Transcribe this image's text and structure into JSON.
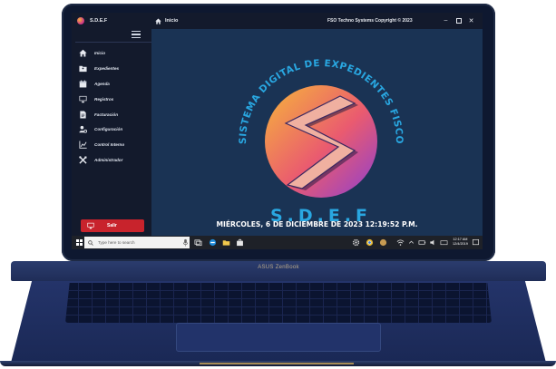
{
  "device": {
    "brand": "ASUS ZenBook"
  },
  "app": {
    "name": "S.D.E.F",
    "copyright": "FSO Techno Systems Copyright ©  2023",
    "breadcrumb": "Inicio"
  },
  "sidebar": {
    "items": [
      {
        "label": "Inicio",
        "icon": "home-icon"
      },
      {
        "label": "Expedientes",
        "icon": "folder-icon"
      },
      {
        "label": "Agenda",
        "icon": "calendar-icon"
      },
      {
        "label": "Registros",
        "icon": "monitor-icon"
      },
      {
        "label": "Facturación",
        "icon": "invoice-icon"
      },
      {
        "label": "Configuración",
        "icon": "user-gear-icon"
      },
      {
        "label": "Control Interno",
        "icon": "chart-icon"
      },
      {
        "label": "Administrador",
        "icon": "tools-icon"
      }
    ],
    "exit_label": "Salir"
  },
  "main": {
    "logo_arc_text": "SISTEMA DIGITAL DE EXPEDIENTES FISCO",
    "logo_acronym": "S.D.E.F",
    "datetime": "MIÉRCOLES, 6 DE DICIEMBRE DE 2023 12:19:52 P.M."
  },
  "taskbar": {
    "search_placeholder": "Type here to search",
    "clock_time": "12:17 AM",
    "clock_date": "12/4/2019"
  },
  "colors": {
    "sidebar": "#131a2c",
    "main_background": "#1a3354",
    "exit_button": "#c8232c",
    "logo_text": "#29a7e1"
  }
}
